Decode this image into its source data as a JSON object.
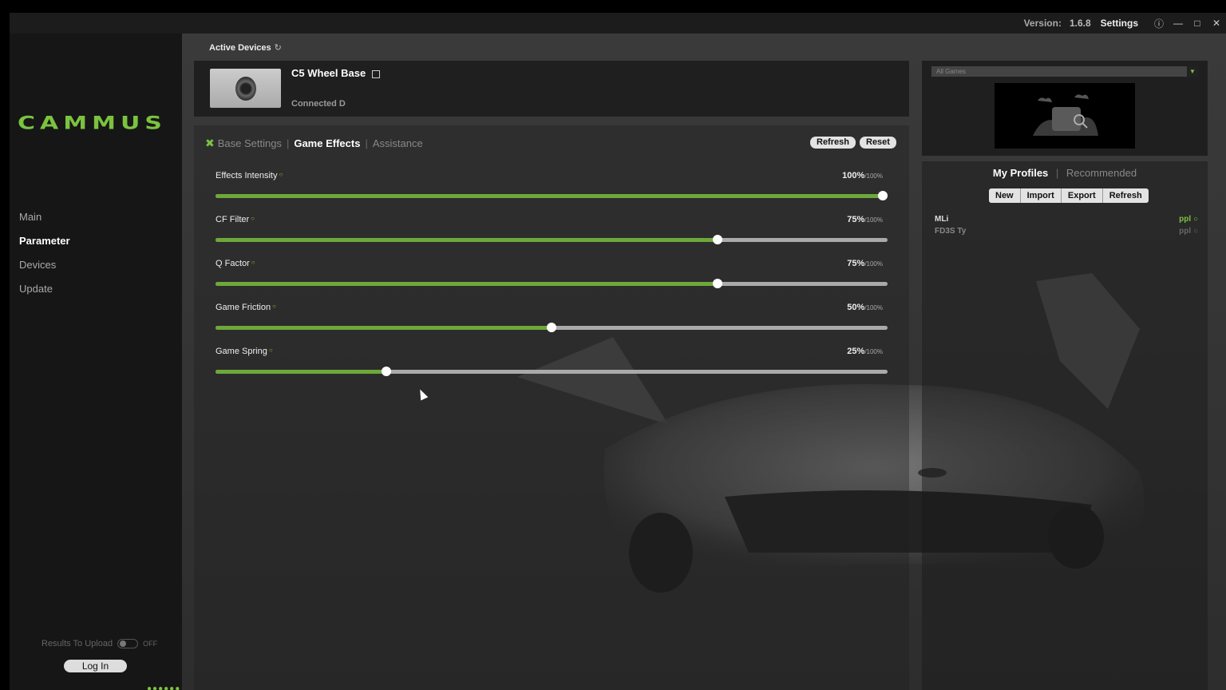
{
  "titlebar": {
    "version_label": "Version:",
    "version_value": "1.6.8",
    "settings_label": "Settings",
    "icons": [
      "help-icon",
      "minimize-icon",
      "maximize-icon",
      "close-icon"
    ]
  },
  "sidebar": {
    "logo": "CAMMUS",
    "items": [
      {
        "label": "Main",
        "active": false
      },
      {
        "label": "Parameter",
        "active": true
      },
      {
        "label": "Devices",
        "active": false
      },
      {
        "label": "Update",
        "active": false
      }
    ],
    "upload_label": "Results To Upload",
    "upload_state": "OFF",
    "login_label": "Log In"
  },
  "devices": {
    "header": "Active Devices",
    "device_name": "C5 Wheel Base",
    "device_status": "Connected D"
  },
  "effects": {
    "tabs": [
      "Base Settings",
      "Game Effects",
      "Assistance"
    ],
    "active_tab": "Game Effects",
    "refresh_label": "Refresh",
    "reset_label": "Reset",
    "max_label": "/100%",
    "sliders": [
      {
        "label": "Effects Intensity",
        "value": "100%",
        "percent": 100
      },
      {
        "label": "CF Filter",
        "value": "75%",
        "percent": 75
      },
      {
        "label": "Q Factor",
        "value": "75%",
        "percent": 75
      },
      {
        "label": "Game Friction",
        "value": "50%",
        "percent": 50
      },
      {
        "label": "Game Spring",
        "value": "25%",
        "percent": 25
      }
    ]
  },
  "games": {
    "select_value": "All Games"
  },
  "profiles": {
    "tab_my": "My Profiles",
    "tab_recommended": "Recommended",
    "buttons": [
      "New",
      "Import",
      "Export",
      "Refresh"
    ],
    "items": [
      {
        "name": "MLi",
        "action": "ppl",
        "active": true
      },
      {
        "name": "FD3S Ty",
        "action": "ppl",
        "active": false
      }
    ]
  },
  "colors": {
    "accent": "#7bc240",
    "slider_fill": "#6ea83a"
  }
}
